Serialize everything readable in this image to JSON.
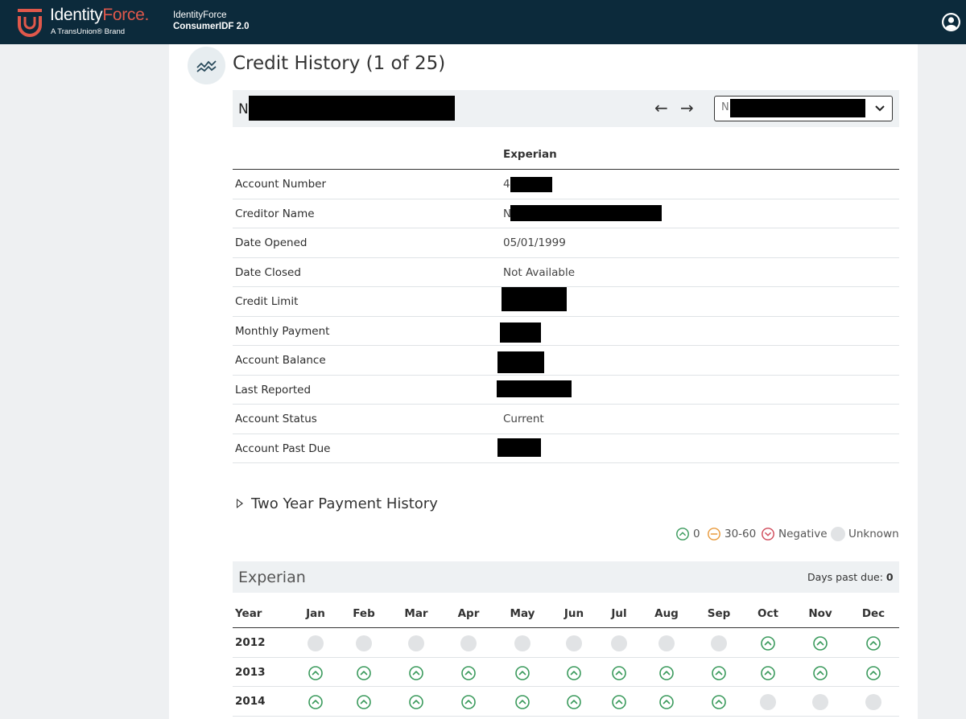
{
  "header": {
    "logo_text_a": "Identity",
    "logo_text_b": "Force",
    "logo_mark": ".",
    "logo_sub": "A TransUnion® Brand",
    "app_line1": "IdentityForce",
    "app_line2": "ConsumerIDF 2.0",
    "icons": {
      "user": "user-circle-icon",
      "logo": "shield-logo-icon"
    }
  },
  "page": {
    "title": "Credit History (1 of 25)",
    "title_icon": "credit-trend-icon",
    "account_name_visible": "N",
    "account_select_visible": "N",
    "prev_label": "←",
    "next_label": "→"
  },
  "details": {
    "bureau": "Experian",
    "rows": [
      {
        "label": "Account Number",
        "value": "4",
        "redacted": true
      },
      {
        "label": "Creditor Name",
        "value": "N",
        "redacted": true
      },
      {
        "label": "Date Opened",
        "value": "05/01/1999",
        "redacted": false
      },
      {
        "label": "Date Closed",
        "value": "Not Available",
        "redacted": false
      },
      {
        "label": "Credit Limit",
        "value": "",
        "redacted": true
      },
      {
        "label": "Monthly Payment",
        "value": "",
        "redacted": true
      },
      {
        "label": "Account Balance",
        "value": "",
        "redacted": true
      },
      {
        "label": "Last Reported",
        "value": "",
        "redacted": true
      },
      {
        "label": "Account Status",
        "value": "Current",
        "redacted": false
      },
      {
        "label": "Account Past Due",
        "value": "",
        "redacted": true
      }
    ]
  },
  "payment_history": {
    "title": "Two Year Payment History",
    "legend": [
      {
        "status": "ok",
        "label": "0"
      },
      {
        "status": "late",
        "label": "30-60"
      },
      {
        "status": "negative",
        "label": "Negative"
      },
      {
        "status": "unknown",
        "label": "Unknown"
      }
    ],
    "bureau": "Experian",
    "days_past_due_label": "Days past due:",
    "days_past_due_value": "0",
    "year_header": "Year",
    "months": [
      "Jan",
      "Feb",
      "Mar",
      "Apr",
      "May",
      "Jun",
      "Jul",
      "Aug",
      "Sep",
      "Oct",
      "Nov",
      "Dec"
    ],
    "years": [
      {
        "year": "2012",
        "statuses": [
          "unknown",
          "unknown",
          "unknown",
          "unknown",
          "unknown",
          "unknown",
          "unknown",
          "unknown",
          "unknown",
          "ok",
          "ok",
          "ok"
        ]
      },
      {
        "year": "2013",
        "statuses": [
          "ok",
          "ok",
          "ok",
          "ok",
          "ok",
          "ok",
          "ok",
          "ok",
          "ok",
          "ok",
          "ok",
          "ok"
        ]
      },
      {
        "year": "2014",
        "statuses": [
          "ok",
          "ok",
          "ok",
          "ok",
          "ok",
          "ok",
          "ok",
          "ok",
          "ok",
          "unknown",
          "unknown",
          "unknown"
        ]
      }
    ],
    "colors": {
      "ok": "#3a9a5c",
      "late": "#e89a3c",
      "negative": "#d04a5a",
      "unknown": "#e1e3e5"
    }
  }
}
